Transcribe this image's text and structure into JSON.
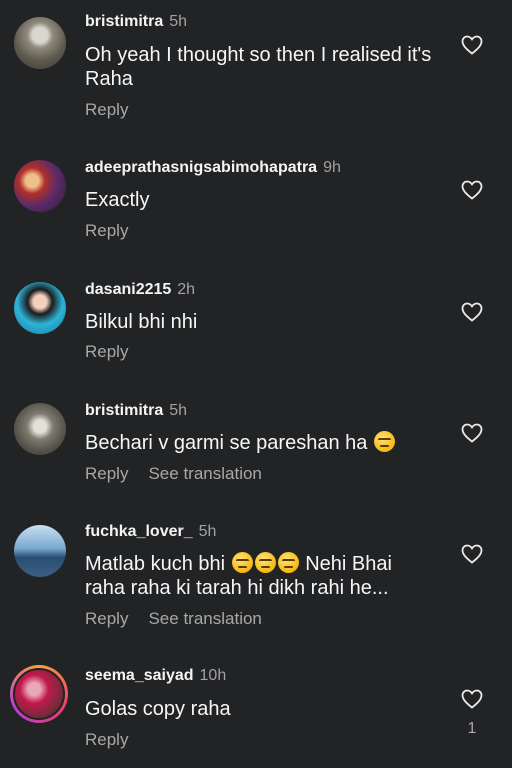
{
  "comments": [
    {
      "username": "bristimitra",
      "time": "5h",
      "text": "Oh yeah I thought so then I realised it's Raha",
      "reply": "Reply",
      "translate": "",
      "likes": ""
    },
    {
      "username": "adeeprathasnigsabimohapatra",
      "time": "9h",
      "text": "Exactly",
      "reply": "Reply",
      "translate": "",
      "likes": ""
    },
    {
      "username": "dasani2215",
      "time": "2h",
      "text": "Bilkul bhi nhi",
      "reply": "Reply",
      "translate": "",
      "likes": ""
    },
    {
      "username": "bristimitra",
      "time": "5h",
      "text": "Bechari v garmi se pareshan ha",
      "emoji": "worried-face-emoji",
      "reply": "Reply",
      "translate": "See translation",
      "likes": ""
    },
    {
      "username": "fuchka_lover_",
      "time": "5h",
      "text_a": "Matlab kuch bhi",
      "emoji": "face-with-rolling-eyes-emoji x3",
      "text_b": "Nehi Bhai raha raha ki tarah hi dikh rahi he...",
      "reply": "Reply",
      "translate": "See translation",
      "likes": ""
    },
    {
      "username": "seema_saiyad",
      "time": "10h",
      "text": "Golas copy raha",
      "reply": "Reply",
      "translate": "",
      "likes": "1"
    }
  ],
  "icons": {
    "like": "heart-outline-icon"
  },
  "colors": {
    "background": "#222325",
    "secondary_text": "#a8a8a8"
  }
}
